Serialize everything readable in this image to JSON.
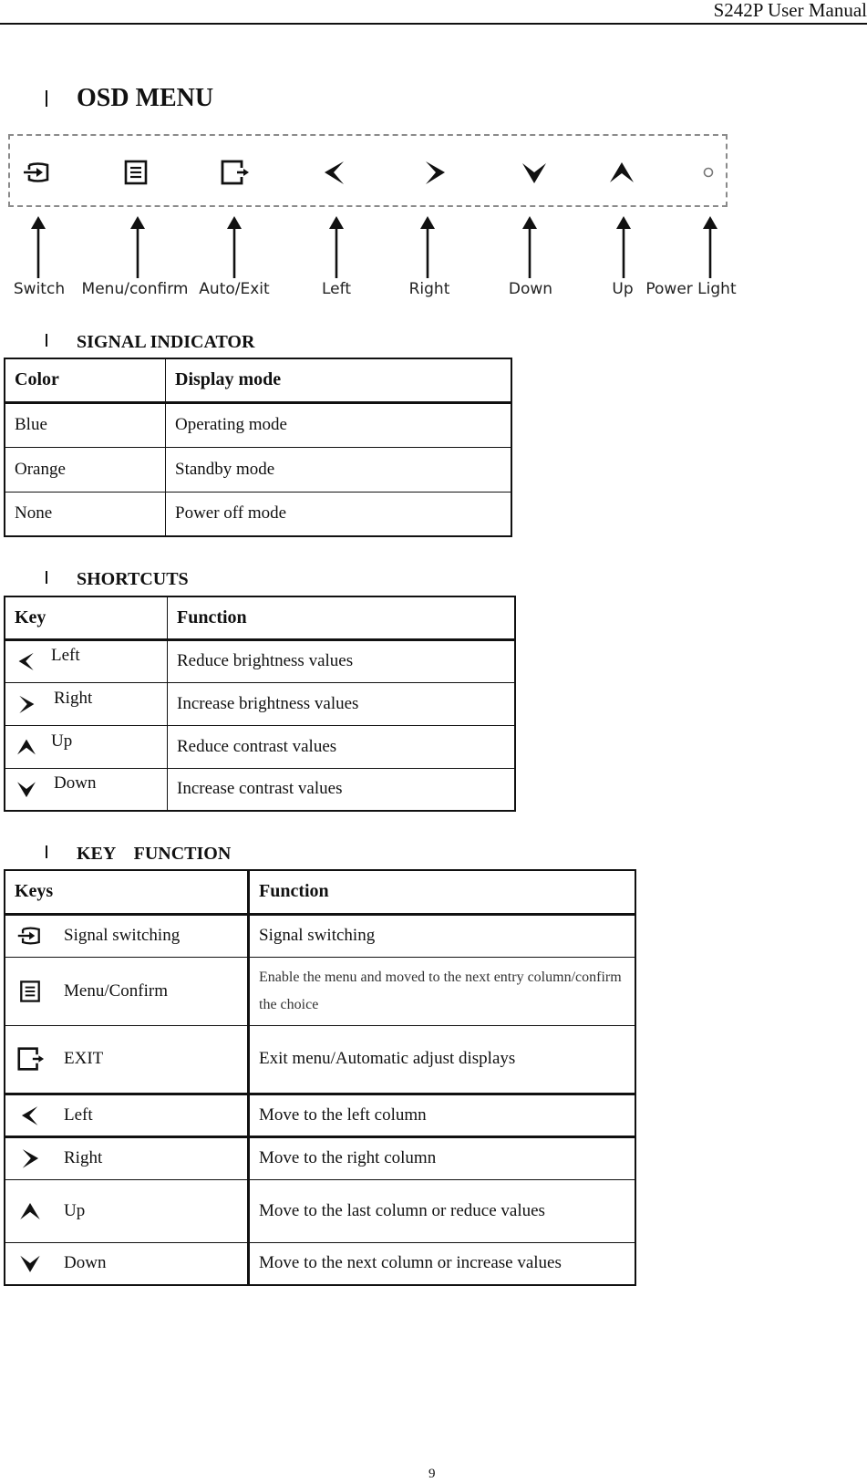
{
  "header": {
    "title": "S242P User Manual"
  },
  "osd_menu": {
    "title": "OSD MENU",
    "buttons": [
      {
        "icon": "input-switch-icon",
        "label": "Switch"
      },
      {
        "icon": "menu-list-icon",
        "label": "Menu/confirm"
      },
      {
        "icon": "exit-icon",
        "label": "Auto/Exit"
      },
      {
        "icon": "chevron-left-icon",
        "label": "Left"
      },
      {
        "icon": "chevron-right-icon",
        "label": "Right"
      },
      {
        "icon": "chevron-down-icon",
        "label": "Down"
      },
      {
        "icon": "chevron-up-icon",
        "label": "Up"
      },
      {
        "icon": "power-light-icon",
        "label": "Power Light"
      }
    ]
  },
  "signal_indicator": {
    "title": "SIGNAL INDICATOR",
    "headers": [
      "Color",
      "Display mode"
    ],
    "rows": [
      [
        "Blue",
        "Operating mode"
      ],
      [
        "Orange",
        "Standby mode"
      ],
      [
        "None",
        "Power off mode"
      ]
    ]
  },
  "shortcuts": {
    "title": "SHORTCUTS",
    "headers": [
      "Key",
      "Function"
    ],
    "rows": [
      {
        "icon": "chevron-left-icon",
        "key": "Left",
        "function": "Reduce brightness values"
      },
      {
        "icon": "chevron-right-icon",
        "key": "Right",
        "function": "Increase brightness values"
      },
      {
        "icon": "chevron-up-icon",
        "key": "Up",
        "function": "Reduce contrast values"
      },
      {
        "icon": "chevron-down-icon",
        "key": "Down",
        "function": "Increase contrast values"
      }
    ]
  },
  "key_function": {
    "title": "KEY    FUNCTION",
    "headers": [
      "Keys",
      "Function"
    ],
    "rows": [
      {
        "icon": "input-switch-icon",
        "key": "Signal switching",
        "function": "Signal switching"
      },
      {
        "icon": "menu-list-icon",
        "key": "Menu/Confirm",
        "function": "Enable the menu and moved to the next entry column/confirm the choice"
      },
      {
        "icon": "exit-icon",
        "key": "EXIT",
        "function": "Exit menu/Automatic adjust displays"
      },
      {
        "icon": "chevron-left-icon",
        "key": "Left",
        "function": "Move to the left column"
      },
      {
        "icon": "chevron-right-icon",
        "key": "Right",
        "function": "Move to the right column"
      },
      {
        "icon": "chevron-up-icon",
        "key": "Up",
        "function": "Move to the last column or reduce values"
      },
      {
        "icon": "chevron-down-icon",
        "key": "Down",
        "function": "Move to the next column or increase values"
      }
    ]
  },
  "footer": {
    "page_number": "9"
  }
}
